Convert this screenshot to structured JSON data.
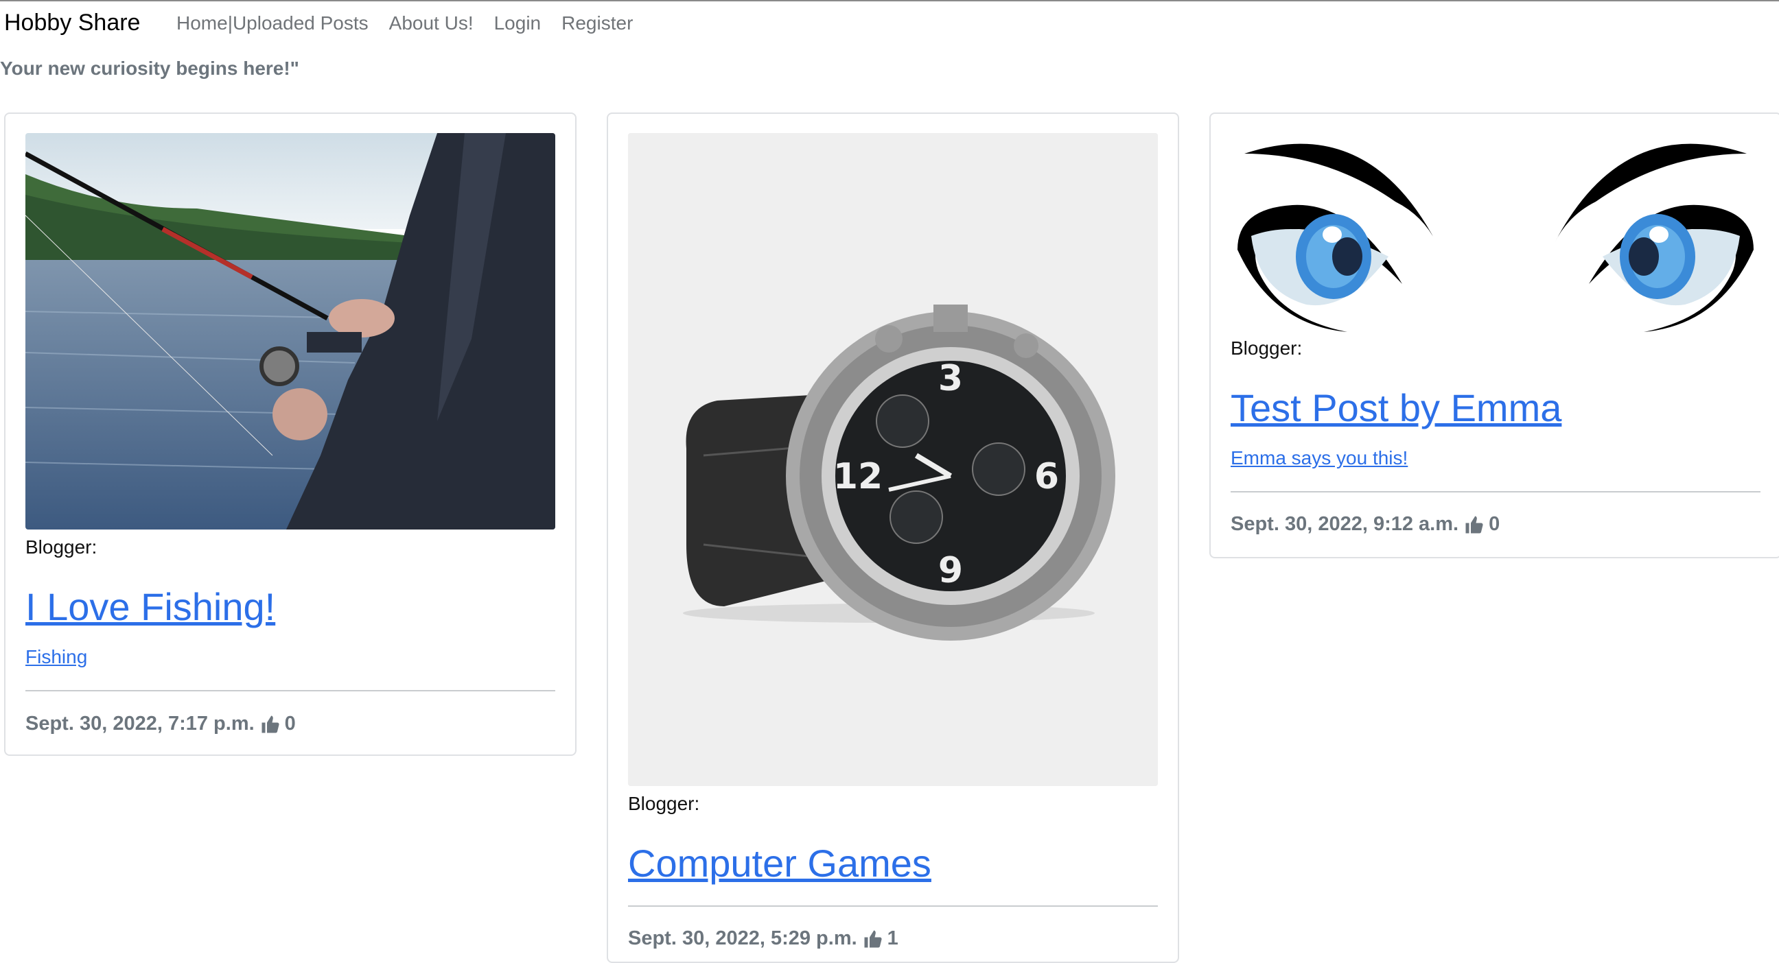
{
  "navbar": {
    "brand": "Hobby Share",
    "links": [
      {
        "label": "Home|Uploaded Posts"
      },
      {
        "label": "About Us!"
      },
      {
        "label": "Login"
      },
      {
        "label": "Register"
      }
    ]
  },
  "tagline": "Your new curiosity begins here!\"",
  "posts": [
    {
      "image_icon": "fishing-photo",
      "blogger_label": "Blogger:",
      "title": "I Love Fishing!",
      "subtitle": "Fishing",
      "date": "Sept. 30, 2022, 7:17 p.m.",
      "likes": "0"
    },
    {
      "image_icon": "wristwatch-photo",
      "blogger_label": "Blogger:",
      "title": "Computer Games",
      "subtitle": "",
      "date": "Sept. 30, 2022, 5:29 p.m.",
      "likes": "1"
    },
    {
      "image_icon": "cartoon-eyes-image",
      "blogger_label": "Blogger:",
      "title": "Test Post by Emma",
      "subtitle": "Emma says you this!",
      "date": "Sept. 30, 2022, 9:12 a.m.",
      "likes": "0"
    }
  ],
  "colors": {
    "link": "#2c6fe8",
    "muted": "#6c757d",
    "card_border": "#dfe1e4"
  }
}
